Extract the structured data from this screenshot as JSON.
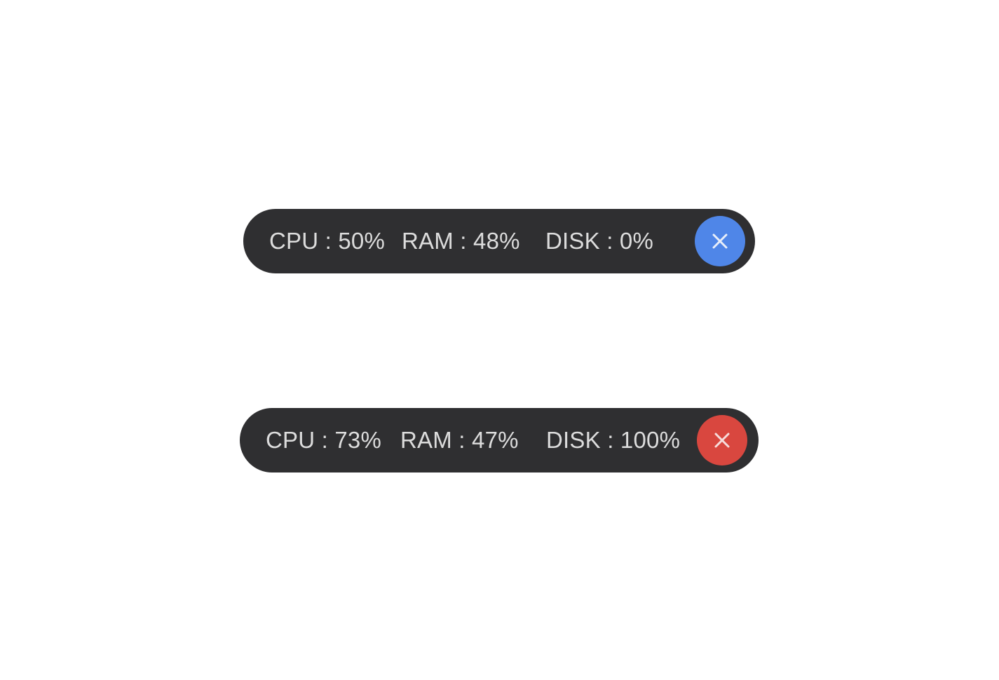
{
  "widgets": [
    {
      "cpu": "CPU : 50%",
      "ram": "RAM : 48%",
      "disk": "DISK : 0%",
      "close_icon": "close-icon",
      "close_color": "#4f86e8"
    },
    {
      "cpu": "CPU : 73%",
      "ram": "RAM : 47%",
      "disk": "DISK : 100%",
      "close_icon": "close-icon",
      "close_color": "#d9473f"
    }
  ]
}
